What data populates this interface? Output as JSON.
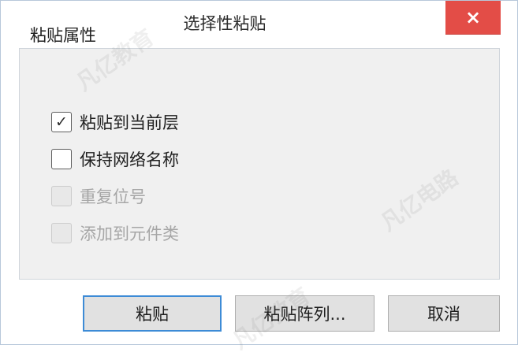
{
  "title": "选择性粘贴",
  "close": {
    "icon": "close-icon",
    "label": "×"
  },
  "group": {
    "title": "粘贴属性",
    "options": [
      {
        "label": "粘贴到当前层",
        "checked": true,
        "enabled": true
      },
      {
        "label": "保持网络名称",
        "checked": false,
        "enabled": true
      },
      {
        "label": "重复位号",
        "checked": false,
        "enabled": false
      },
      {
        "label": "添加到元件类",
        "checked": false,
        "enabled": false
      }
    ]
  },
  "buttons": {
    "paste": "粘贴",
    "paste_array": "粘贴阵列...",
    "cancel": "取消"
  },
  "check_glyph": "✓",
  "watermark": {
    "text_1": "凡亿教育",
    "text_2": "凡亿电路"
  },
  "colors": {
    "close_bg": "#e34d47",
    "accent": "#3d8bd6",
    "panel": "#f0f0f0"
  }
}
